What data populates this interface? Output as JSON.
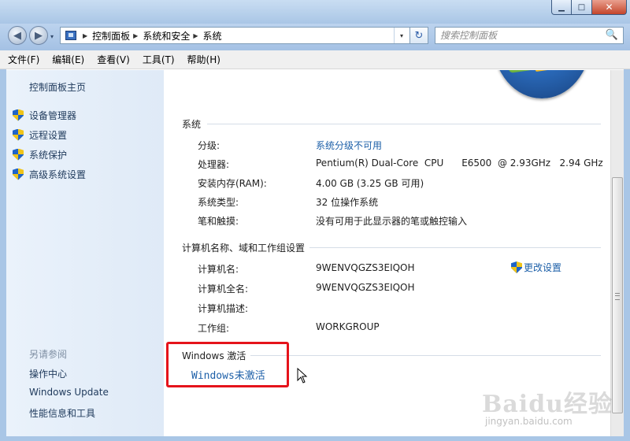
{
  "window": {
    "minimize_glyph": "▁",
    "maximize_glyph": "□",
    "close_glyph": "✕"
  },
  "nav": {
    "back_glyph": "◀",
    "forward_glyph": "▶",
    "history_glyph": "▾",
    "address_crumbs": [
      "控制面板",
      "系统和安全",
      "系统"
    ],
    "crumb_separator": "▶",
    "address_drop_glyph": "▾",
    "refresh_glyph": "↻",
    "search_placeholder": "搜索控制面板",
    "search_glyph": "🔍"
  },
  "menubar": {
    "items": [
      "文件(F)",
      "编辑(E)",
      "查看(V)",
      "工具(T)",
      "帮助(H)"
    ]
  },
  "sidebar": {
    "home": "控制面板主页",
    "tasks": [
      "设备管理器",
      "远程设置",
      "系统保护",
      "高级系统设置"
    ],
    "see_also_title": "另请参阅",
    "see_also": [
      "操作中心",
      "Windows Update",
      "性能信息和工具"
    ]
  },
  "system": {
    "title": "系统",
    "rows": [
      {
        "label": "分级:",
        "value": "系统分级不可用",
        "is_link": true
      },
      {
        "label": "处理器:",
        "value": "Pentium(R) Dual-Core  CPU      E6500  @ 2.93GHz   2.94 GHz",
        "is_link": false
      },
      {
        "label": "安装内存(RAM):",
        "value": "4.00 GB (3.25 GB 可用)",
        "is_link": false
      },
      {
        "label": "系统类型:",
        "value": "32 位操作系统",
        "is_link": false
      },
      {
        "label": "笔和触摸:",
        "value": "没有可用于此显示器的笔或触控输入",
        "is_link": false
      }
    ]
  },
  "computer": {
    "title": "计算机名称、域和工作组设置",
    "change_settings": "更改设置",
    "rows": [
      {
        "label": "计算机名:",
        "value": "9WENVQGZS3EIQOH"
      },
      {
        "label": "计算机全名:",
        "value": "9WENVQGZS3EIQOH"
      },
      {
        "label": "计算机描述:",
        "value": ""
      },
      {
        "label": "工作组:",
        "value": "WORKGROUP"
      }
    ]
  },
  "activation": {
    "title": "Windows 激活",
    "status_link": "Windows未激活"
  },
  "watermark": {
    "brand": "Baidu经验",
    "url": "jingyan.baidu.com"
  },
  "colors": {
    "link": "#1c5fa8",
    "highlight": "#e5131b",
    "sidebar_link": "#1e395b"
  }
}
